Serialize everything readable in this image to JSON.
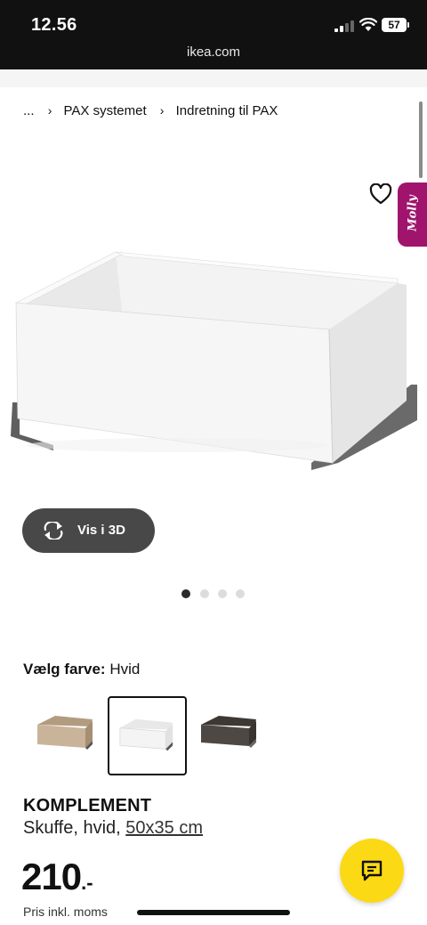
{
  "status_bar": {
    "time": "12.56",
    "url": "ikea.com",
    "battery": "57"
  },
  "breadcrumb": {
    "items": [
      "...",
      "PAX systemet",
      "Indretning til PAX"
    ]
  },
  "assistant_tab": {
    "label": "Molly"
  },
  "view3d": {
    "label": "Vis i 3D"
  },
  "carousel": {
    "total": 4,
    "active": 0
  },
  "color_selector": {
    "label": "Vælg farve:",
    "value": "Hvid",
    "options": [
      {
        "name": "eg-effekt",
        "color": "#c9b49a",
        "selected": false
      },
      {
        "name": "Hvid",
        "color": "#f2f2f2",
        "selected": true
      },
      {
        "name": "mørk",
        "color": "#4e4845",
        "selected": false
      }
    ]
  },
  "product": {
    "name": "KOMPLEMENT",
    "description": "Skuffe, hvid,",
    "size_link": "50x35 cm",
    "price": "210",
    "price_suffix": ".-",
    "price_note": "Pris inkl. moms"
  },
  "colors": {
    "accent_yellow": "#fbd914",
    "assistant_magenta": "#a0146e",
    "dark_button": "#484848"
  }
}
